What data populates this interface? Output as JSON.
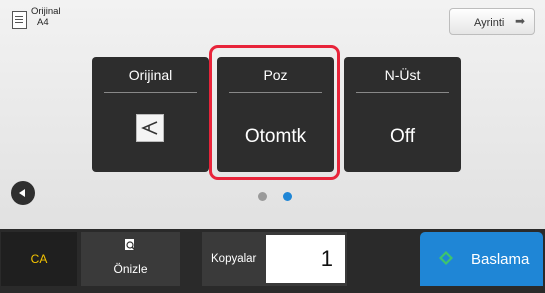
{
  "original_indicator": {
    "label": "Orijinal",
    "size": "A4",
    "icon": "document-icon"
  },
  "detail_button": {
    "label": "Ayrinti",
    "icon": "arrow-right-icon"
  },
  "keys": [
    {
      "label": "Orijinal",
      "value": "",
      "icon": "orientation-icon"
    },
    {
      "label": "Poz",
      "value": "Otomtk"
    },
    {
      "label": "N-Üst",
      "value": "Off"
    }
  ],
  "page_indicator": {
    "current": 2,
    "total": 2,
    "active_color": "#1f86d6",
    "inactive_color": "#9a9a9a"
  },
  "bottom_bar": {
    "ca_label": "CA",
    "preview_label": "Önizle",
    "copies_label": "Kopyalar",
    "copies_value": "1",
    "start_label": "Baslama"
  },
  "colors": {
    "highlight": "#e8243a",
    "start_button": "#1f86d6",
    "ca_text": "#f5c400",
    "key_bg": "#2d2d2d"
  }
}
